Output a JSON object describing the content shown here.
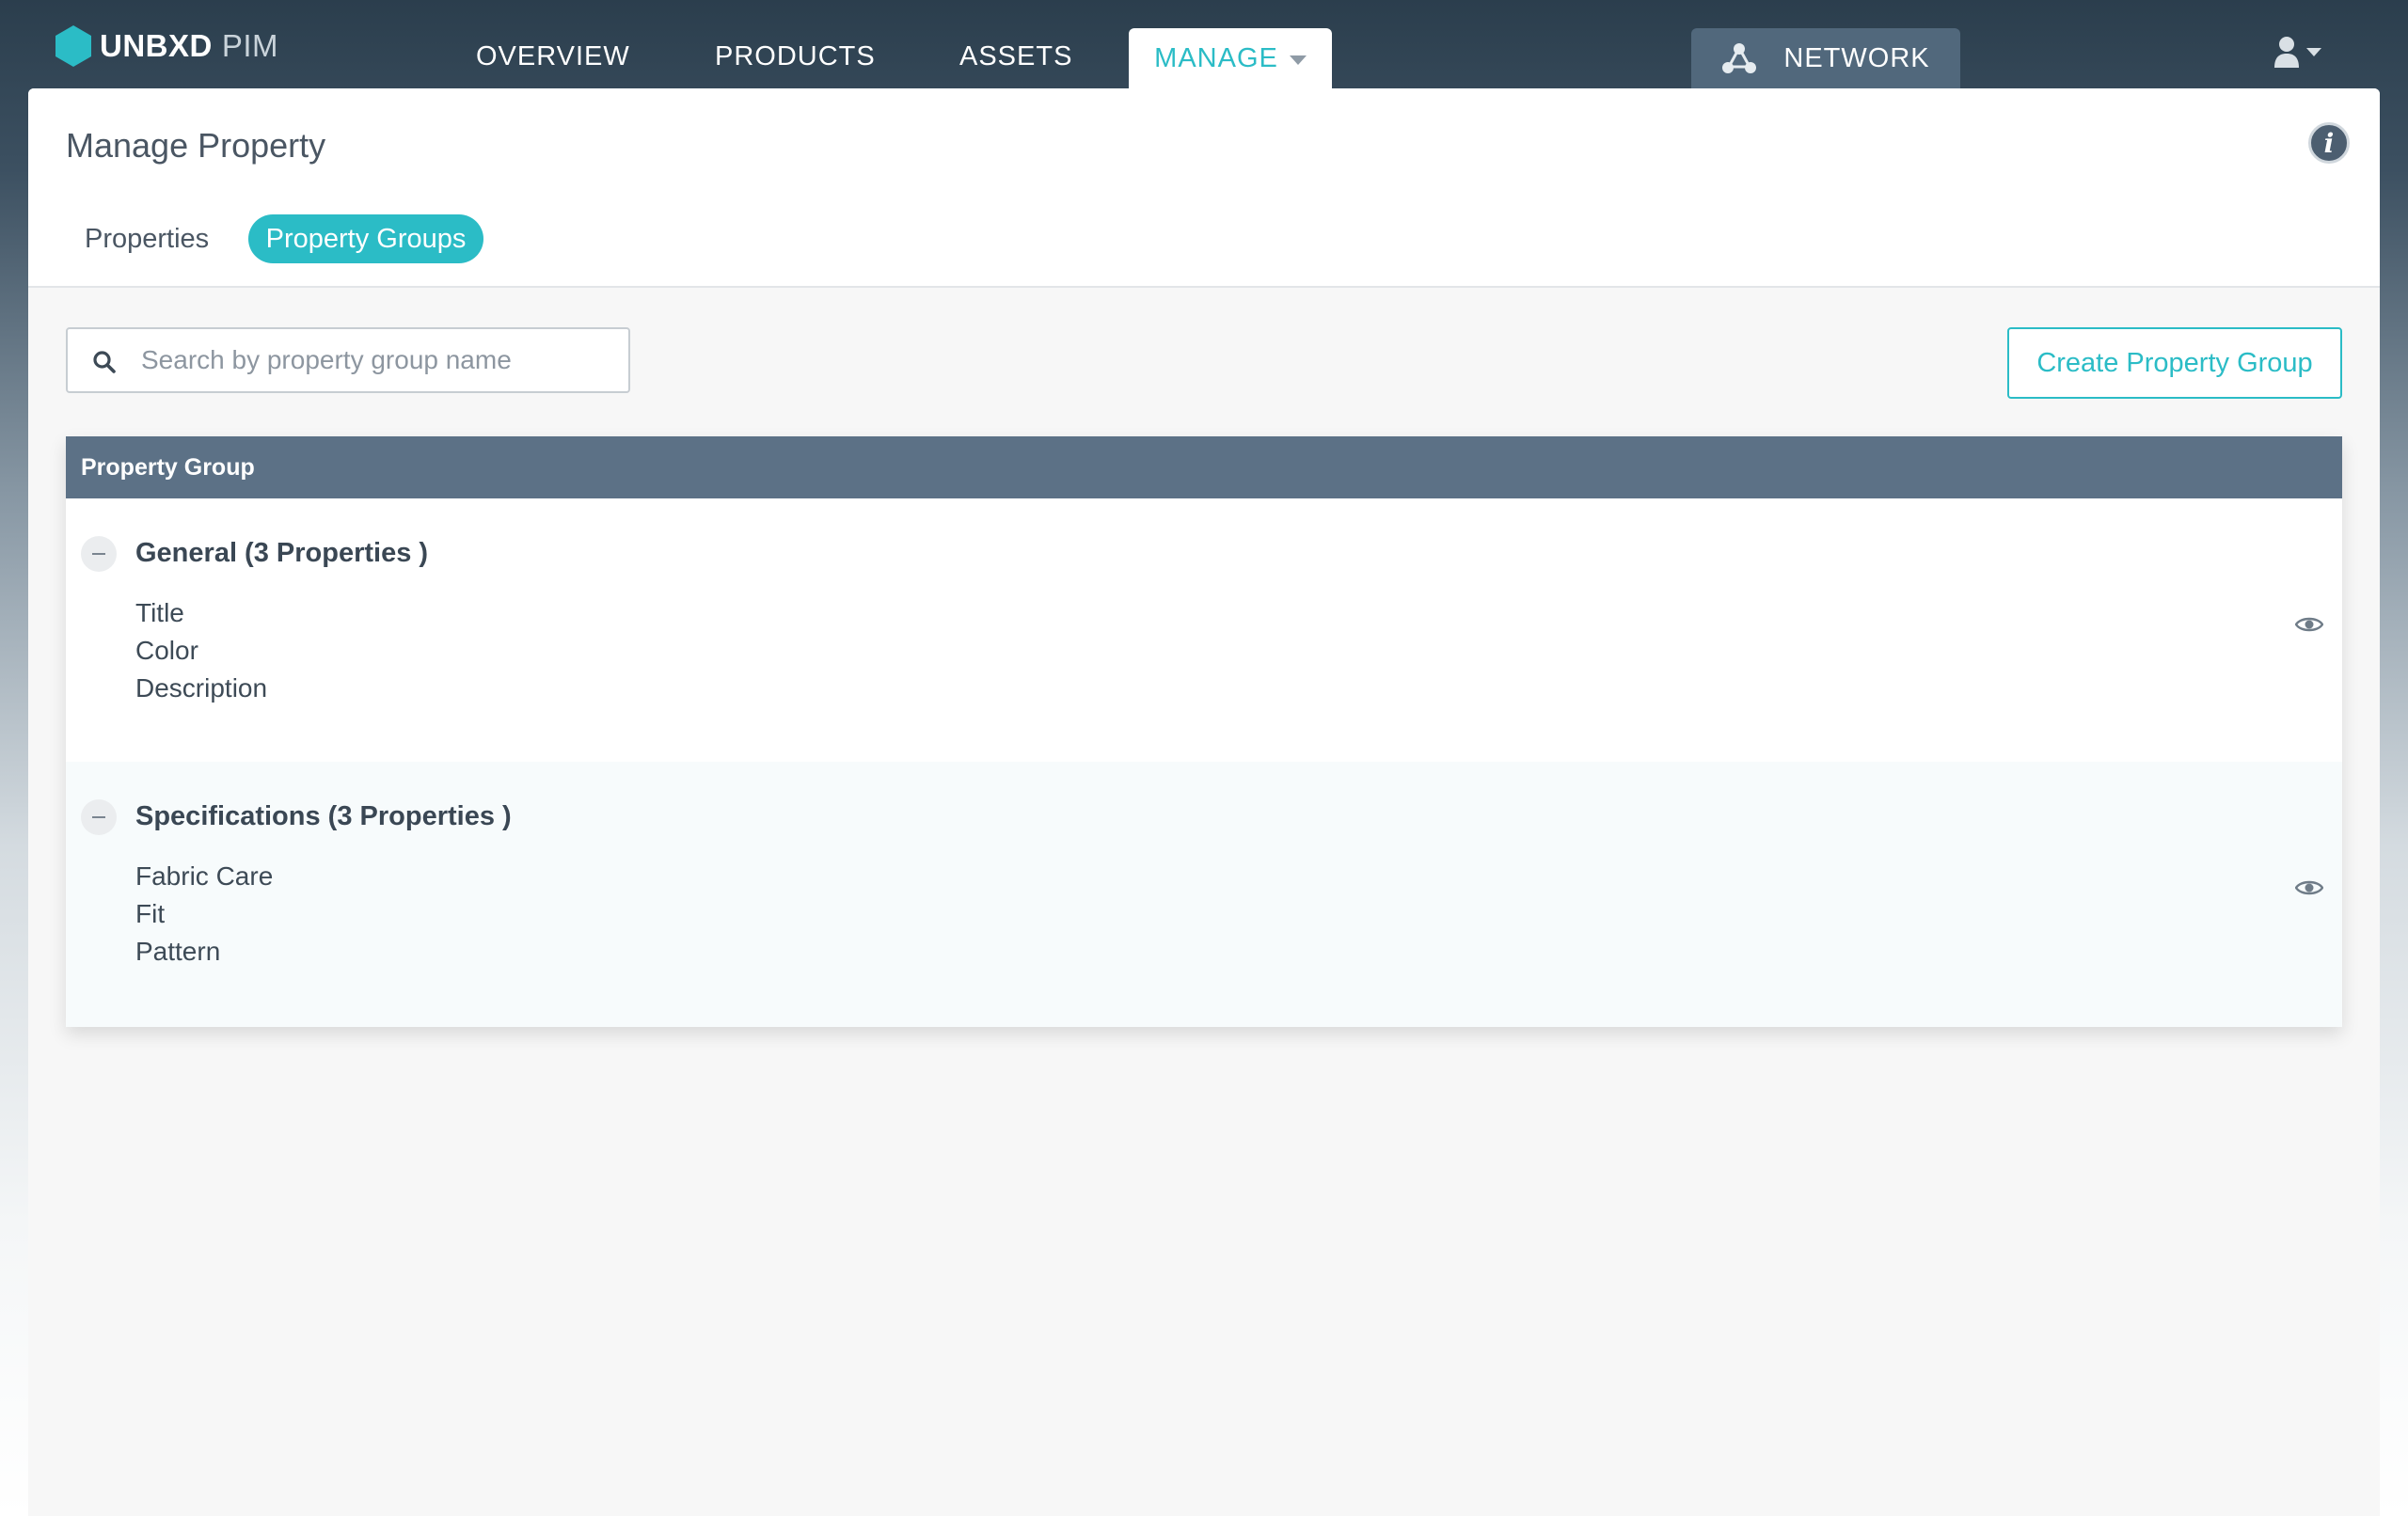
{
  "app": {
    "brand": "UNBXD",
    "product": "PIM"
  },
  "nav": {
    "overview": "OVERVIEW",
    "products": "PRODUCTS",
    "assets": "ASSETS",
    "manage": "MANAGE",
    "network": "NETWORK"
  },
  "page": {
    "title": "Manage Property",
    "tabs": {
      "properties": "Properties",
      "property_groups": "Property Groups"
    },
    "active_tab": "Property Groups"
  },
  "search": {
    "placeholder": "Search by property group name",
    "value": ""
  },
  "actions": {
    "create_label": "Create Property Group"
  },
  "table": {
    "header": "Property Group",
    "groups": [
      {
        "title": "General (3 Properties )",
        "properties": [
          "Title",
          "Color",
          "Description"
        ]
      },
      {
        "title": "Specifications (3 Properties )",
        "properties": [
          "Fabric Care",
          "Fit",
          "Pattern"
        ]
      }
    ]
  },
  "colors": {
    "accent": "#2bbcc6",
    "topbar": "#2b3e4d",
    "table_header": "#5c7186",
    "network_tab": "#51687c"
  },
  "icons": {
    "logo": "hexagon-logo-icon",
    "network": "network-nodes-icon",
    "user": "user-icon",
    "info": "info-icon",
    "search": "search-icon",
    "collapse": "collapse-minus-icon",
    "view": "eye-icon"
  }
}
